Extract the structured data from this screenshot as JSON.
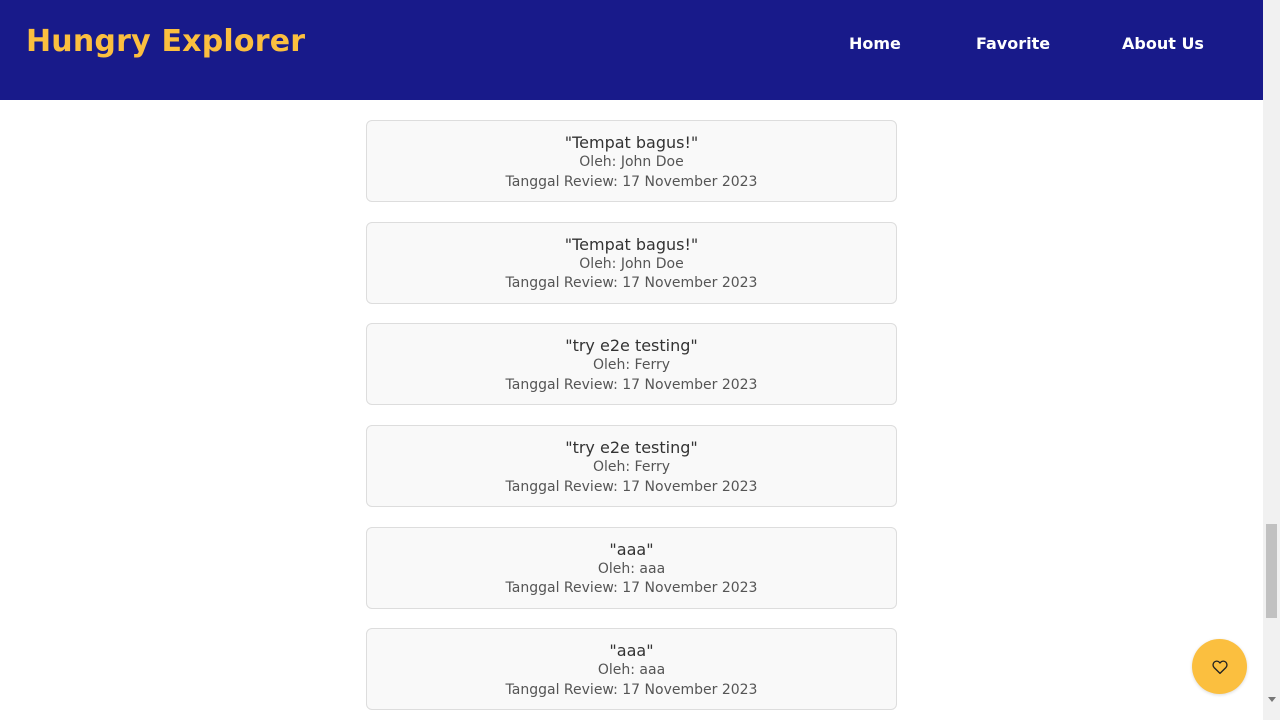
{
  "header": {
    "brand": "Hungry Explorer",
    "nav": [
      {
        "label": "Home"
      },
      {
        "label": "Favorite"
      },
      {
        "label": "About Us"
      }
    ]
  },
  "reviews": [
    {
      "text": "\"Tempat bagus!\"",
      "author": "Oleh: John Doe",
      "date": "Tanggal Review: 17 November 2023"
    },
    {
      "text": "\"Tempat bagus!\"",
      "author": "Oleh: John Doe",
      "date": "Tanggal Review: 17 November 2023"
    },
    {
      "text": "\"try e2e testing\"",
      "author": "Oleh: Ferry",
      "date": "Tanggal Review: 17 November 2023"
    },
    {
      "text": "\"try e2e testing\"",
      "author": "Oleh: Ferry",
      "date": "Tanggal Review: 17 November 2023"
    },
    {
      "text": "\"aaa\"",
      "author": "Oleh: aaa",
      "date": "Tanggal Review: 17 November 2023"
    },
    {
      "text": "\"aaa\"",
      "author": "Oleh: aaa",
      "date": "Tanggal Review: 17 November 2023"
    }
  ],
  "fab": {
    "icon": "heart-icon"
  },
  "colors": {
    "header_bg": "#181a8a",
    "brand": "#fbbf3f",
    "fab_bg": "#fbbf3f"
  }
}
